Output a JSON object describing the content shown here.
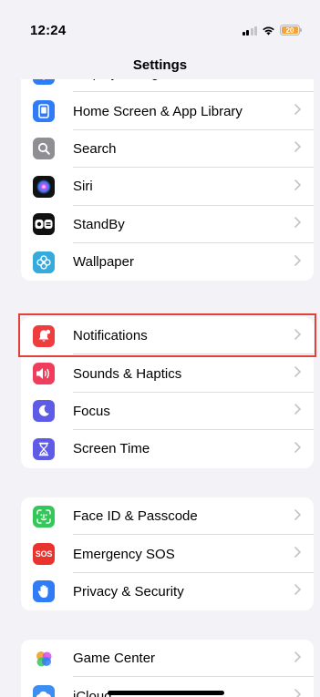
{
  "status_bar": {
    "time": "12:24",
    "battery": "20"
  },
  "nav": {
    "title": "Settings"
  },
  "groups": [
    {
      "items": [
        {
          "label": "Display & Brightness",
          "icon": "display-brightness-icon",
          "color": "#2f7cf6"
        },
        {
          "label": "Home Screen & App Library",
          "icon": "home-screen-icon",
          "color": "#2f7cf6"
        },
        {
          "label": "Search",
          "icon": "search-icon",
          "color": "#8e8e93"
        },
        {
          "label": "Siri",
          "icon": "siri-icon",
          "color": "#111111"
        },
        {
          "label": "StandBy",
          "icon": "standby-icon",
          "color": "#111111"
        },
        {
          "label": "Wallpaper",
          "icon": "wallpaper-icon",
          "color": "#35aadc"
        }
      ]
    },
    {
      "items": [
        {
          "label": "Notifications",
          "icon": "bell-icon",
          "color": "#ef3d3d"
        },
        {
          "label": "Sounds & Haptics",
          "icon": "speaker-icon",
          "color": "#ef3d5b"
        },
        {
          "label": "Focus",
          "icon": "moon-icon",
          "color": "#5e5ce6"
        },
        {
          "label": "Screen Time",
          "icon": "hourglass-icon",
          "color": "#5e5ce6"
        }
      ]
    },
    {
      "items": [
        {
          "label": "Face ID & Passcode",
          "icon": "face-id-icon",
          "color": "#34c759"
        },
        {
          "label": "Emergency SOS",
          "icon": "sos-icon",
          "color": "#e8332e",
          "icon_text": "SOS"
        },
        {
          "label": "Privacy & Security",
          "icon": "hand-icon",
          "color": "#2f7cf6"
        }
      ]
    },
    {
      "items": [
        {
          "label": "Game Center",
          "icon": "game-center-icon",
          "color": "#ffffff"
        },
        {
          "label": "iCloud",
          "icon": "icloud-icon",
          "color": "#3d8ef0"
        }
      ]
    }
  ],
  "highlight_color": "#e2413a"
}
